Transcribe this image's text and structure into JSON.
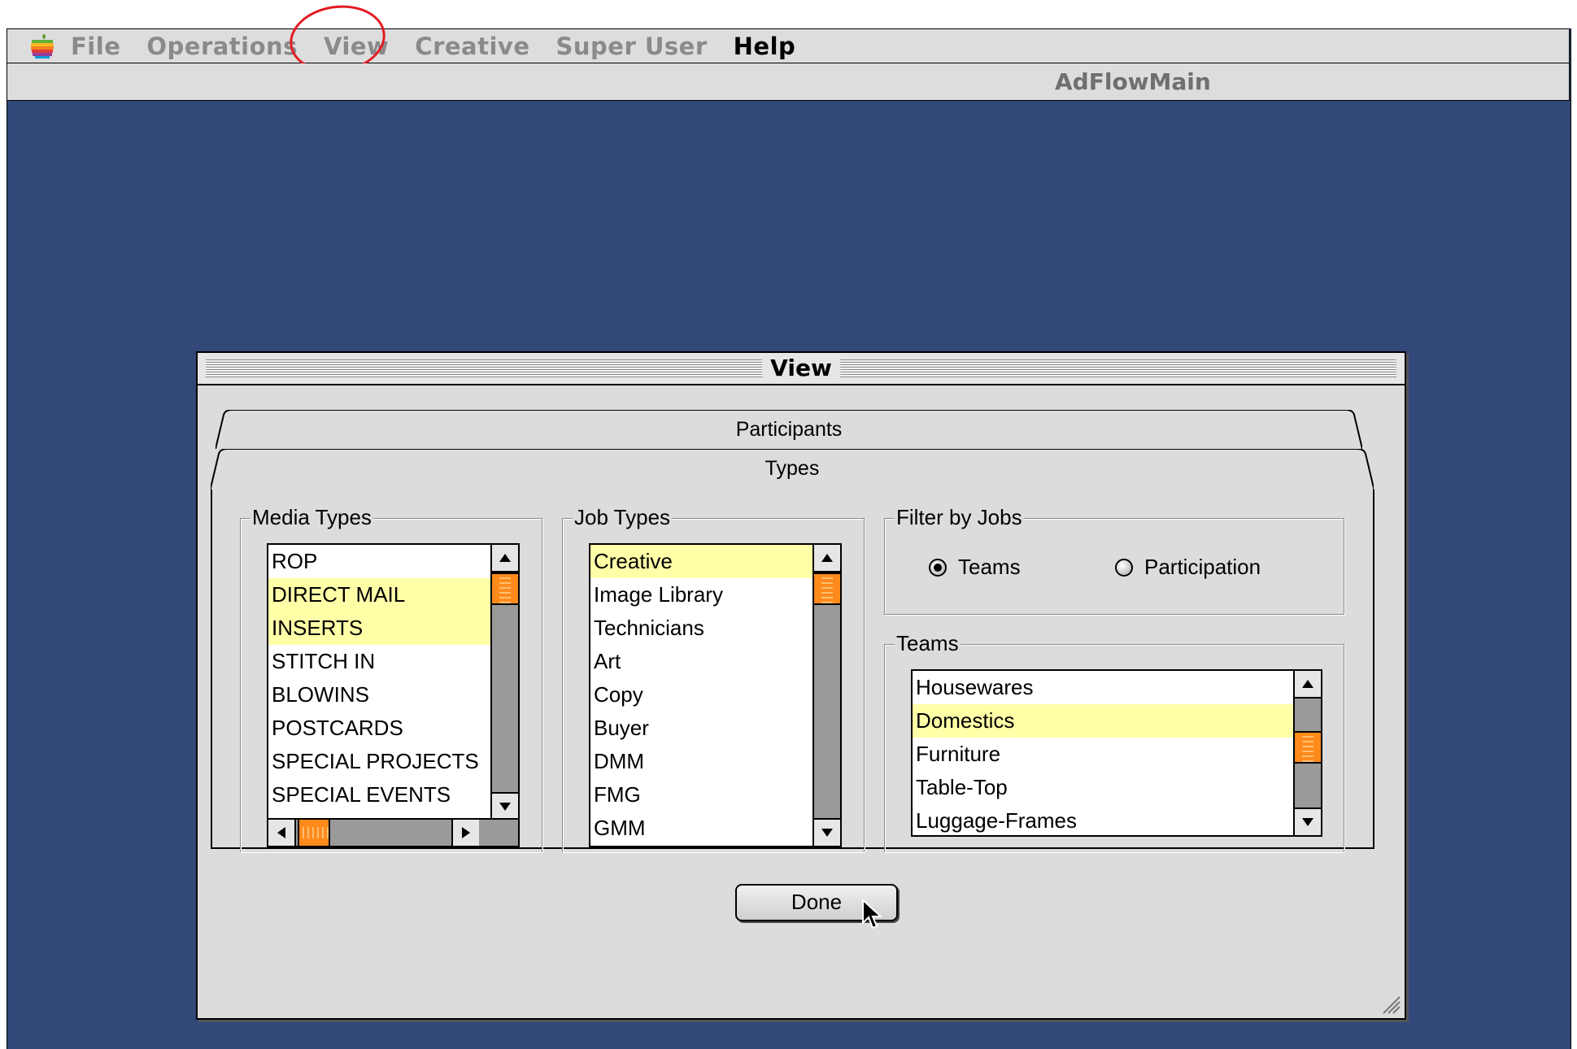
{
  "menubar": {
    "items": [
      {
        "label": "File",
        "active": false
      },
      {
        "label": "Operations",
        "active": false
      },
      {
        "label": "View",
        "active": false
      },
      {
        "label": "Creative",
        "active": false
      },
      {
        "label": "Super User",
        "active": false
      },
      {
        "label": "Help",
        "active": true
      }
    ]
  },
  "window": {
    "title": "AdFlowMain"
  },
  "dialog": {
    "title": "View",
    "tabs": {
      "back": "Participants",
      "front": "Types"
    },
    "media_types": {
      "label": "Media Types",
      "items": [
        {
          "text": "ROP",
          "selected": false
        },
        {
          "text": "DIRECT MAIL",
          "selected": true
        },
        {
          "text": "INSERTS",
          "selected": true
        },
        {
          "text": "STITCH IN",
          "selected": false
        },
        {
          "text": "BLOWINS",
          "selected": false
        },
        {
          "text": "POSTCARDS",
          "selected": false
        },
        {
          "text": "SPECIAL PROJECTS",
          "selected": false
        },
        {
          "text": "SPECIAL EVENTS",
          "selected": false
        }
      ]
    },
    "job_types": {
      "label": "Job Types",
      "items": [
        {
          "text": "Creative",
          "selected": true
        },
        {
          "text": "Image Library",
          "selected": false
        },
        {
          "text": "Technicians",
          "selected": false
        },
        {
          "text": "Art",
          "selected": false
        },
        {
          "text": "Copy",
          "selected": false
        },
        {
          "text": "Buyer",
          "selected": false
        },
        {
          "text": "DMM",
          "selected": false
        },
        {
          "text": "FMG",
          "selected": false
        },
        {
          "text": "GMM",
          "selected": false
        }
      ]
    },
    "filter": {
      "label": "Filter by Jobs",
      "options": [
        {
          "text": "Teams",
          "checked": true
        },
        {
          "text": "Participation",
          "checked": false
        }
      ]
    },
    "teams": {
      "label": "Teams",
      "items": [
        {
          "text": "Housewares",
          "selected": false
        },
        {
          "text": "Domestics",
          "selected": true
        },
        {
          "text": "Furniture",
          "selected": false
        },
        {
          "text": "Table-Top",
          "selected": false
        },
        {
          "text": "Luggage-Frames",
          "selected": false
        }
      ]
    },
    "done_label": "Done"
  },
  "colors": {
    "desktop": "#314879",
    "selection": "#ffffa8",
    "scroll_thumb": "#ff8a1c",
    "annotation": "#e31b23"
  }
}
